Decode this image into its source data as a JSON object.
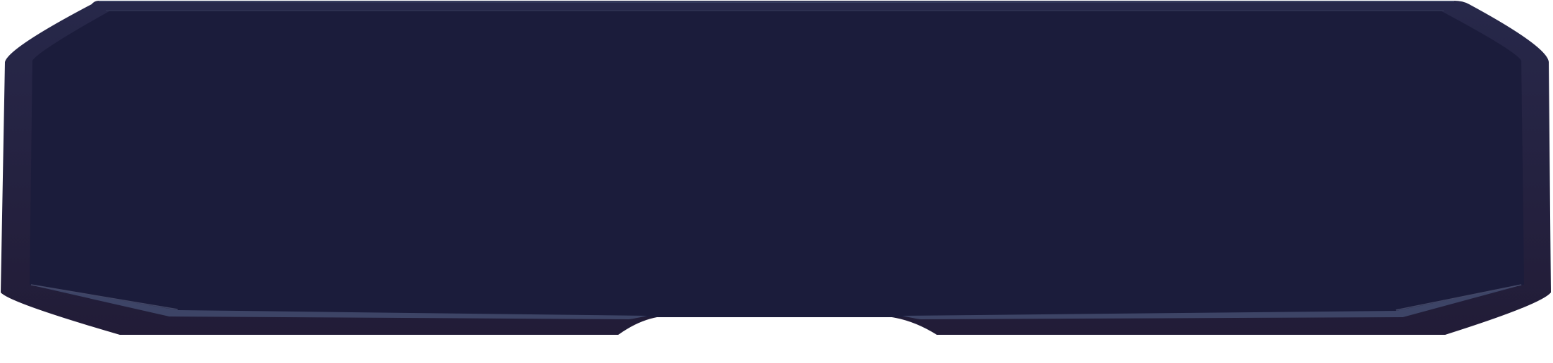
{
  "panel": {
    "colors": {
      "frame_outer": "#252341",
      "frame_bottom": "#221d38",
      "screen_fill": "#1b1c3b",
      "highlight": "#3d4466",
      "highlight_light": "#525878",
      "background": "#ffffff"
    }
  }
}
